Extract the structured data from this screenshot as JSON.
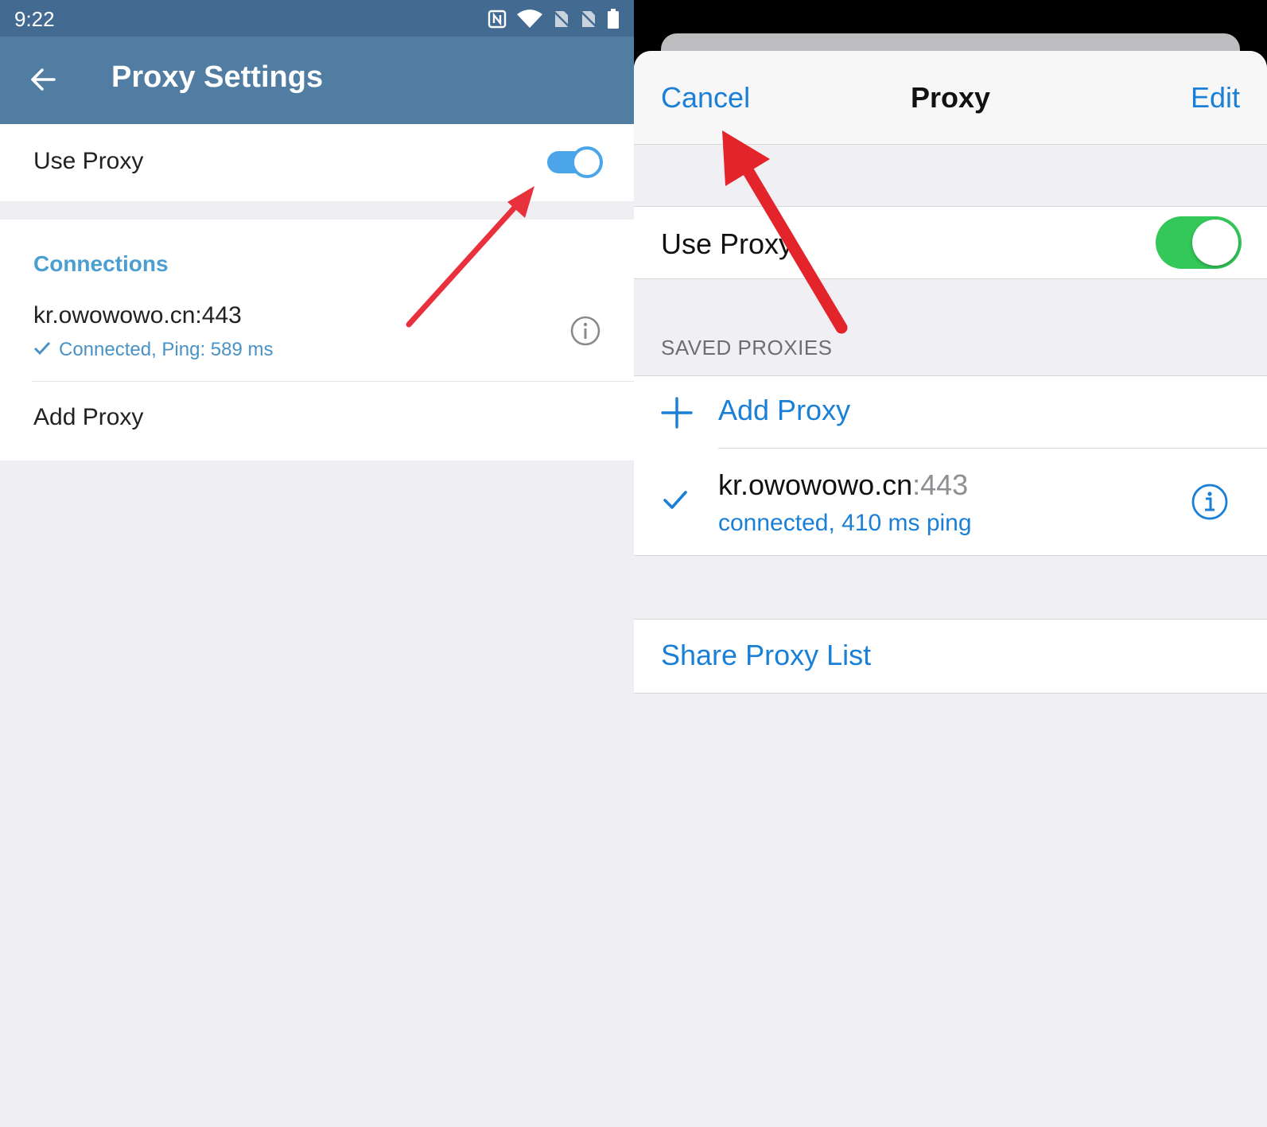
{
  "android": {
    "status_bar": {
      "time": "9:22",
      "icons": [
        "nfc-icon",
        "wifi-icon",
        "no-sim-icon",
        "no-sim-icon",
        "battery-icon"
      ]
    },
    "app_bar": {
      "title": "Proxy Settings",
      "back_icon": "arrow-left-icon"
    },
    "use_proxy": {
      "label": "Use Proxy",
      "enabled": true
    },
    "connections": {
      "header": "Connections",
      "server": "kr.owowowo.cn:443",
      "status": "Connected, Ping: 589 ms"
    },
    "add_proxy_label": "Add Proxy",
    "colors": {
      "app_bar": "#527da3",
      "status_bar": "#436b92",
      "accent": "#4ba5e8"
    }
  },
  "ios": {
    "nav": {
      "cancel": "Cancel",
      "title": "Proxy",
      "edit": "Edit"
    },
    "use_proxy": {
      "label": "Use Proxy",
      "enabled": true
    },
    "saved_proxies_header": "SAVED PROXIES",
    "add_proxy_label": "Add Proxy",
    "proxy": {
      "host": "kr.owowowo.cn",
      "port": ":443",
      "status": "connected, 410 ms ping"
    },
    "share_label": "Share Proxy List",
    "colors": {
      "tint": "#1a7fd6",
      "switch_on": "#34c759"
    }
  },
  "annotations": {
    "arrow_color": "#e3242b"
  }
}
